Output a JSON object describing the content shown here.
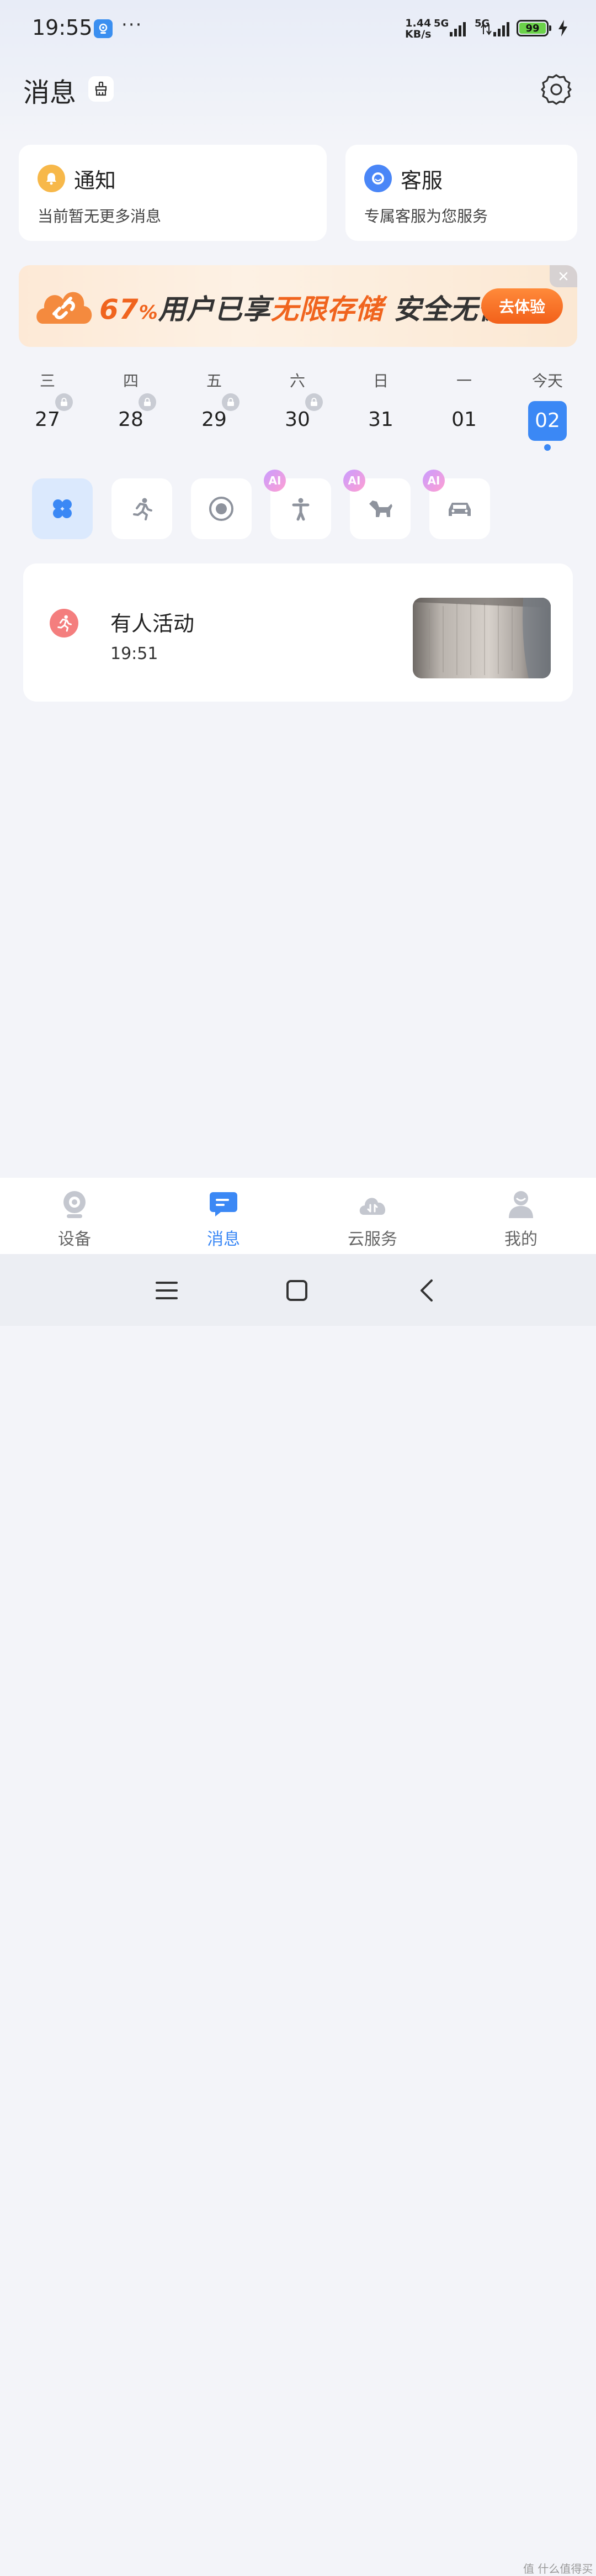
{
  "status_bar": {
    "time": "19:55",
    "more": "···",
    "speed_value": "1.44",
    "speed_unit": "KB/s",
    "net1": "5G",
    "net2": "5G",
    "battery": "99"
  },
  "header": {
    "title": "消息"
  },
  "cards": [
    {
      "title": "通知",
      "subtitle": "当前暂无更多消息",
      "icon": "bell-icon",
      "color": "#f7b84a"
    },
    {
      "title": "客服",
      "subtitle": "专属客服为您服务",
      "icon": "headset-icon",
      "color": "#4a86f7"
    }
  ],
  "banner": {
    "percent": "67",
    "percent_sign": "%",
    "text_a": "用户已享",
    "text_highlight": "无限存储",
    "text_b": " 安全无忧",
    "cta": "去体验"
  },
  "calendar": {
    "days": [
      {
        "weekday": "三",
        "date": "27",
        "locked": true
      },
      {
        "weekday": "四",
        "date": "28",
        "locked": true
      },
      {
        "weekday": "五",
        "date": "29",
        "locked": true
      },
      {
        "weekday": "六",
        "date": "30",
        "locked": true
      },
      {
        "weekday": "日",
        "date": "31",
        "locked": false
      },
      {
        "weekday": "一",
        "date": "01",
        "locked": false
      },
      {
        "weekday": "今天",
        "date": "02",
        "locked": false,
        "selected": true
      }
    ]
  },
  "filters": {
    "ai_label": "AI",
    "items": [
      "all",
      "person-motion",
      "motion",
      "human-ai",
      "pet-ai",
      "vehicle-ai"
    ]
  },
  "events": [
    {
      "title": "有人活动",
      "time": "19:51",
      "icon": "running-person-icon"
    }
  ],
  "bottom_nav": [
    {
      "label": "设备",
      "icon": "camera-icon"
    },
    {
      "label": "消息",
      "icon": "message-icon",
      "active": true
    },
    {
      "label": "云服务",
      "icon": "cloud-icon"
    },
    {
      "label": "我的",
      "icon": "person-icon"
    }
  ],
  "watermark": "值 什么值得买",
  "colors": {
    "accent": "#3b88f5",
    "banner_orange": "#f0641e",
    "event_icon": "#f47e7e"
  }
}
